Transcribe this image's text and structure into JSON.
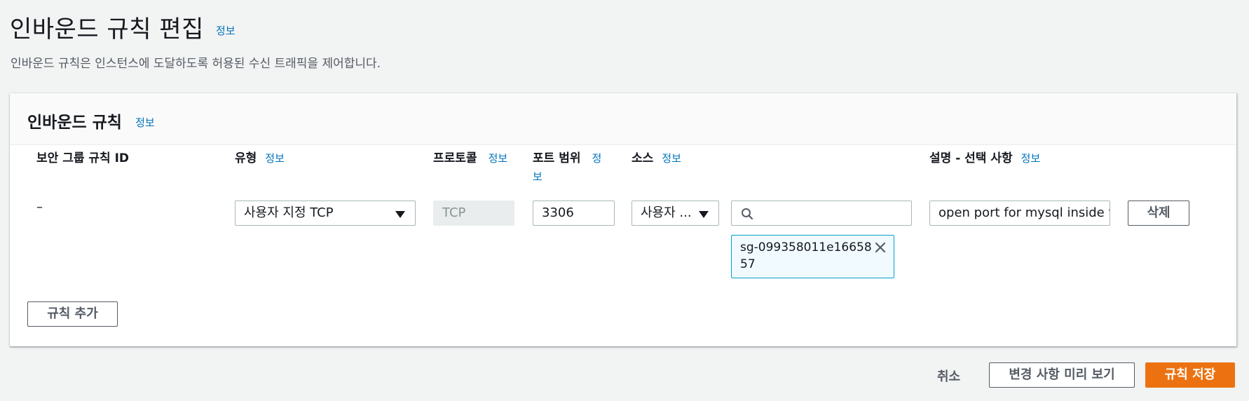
{
  "header": {
    "title": "인바운드 규칙 편집",
    "info": "정보",
    "description": "인바운드 규칙은 인스턴스에 도달하도록 허용된 수신 트래픽을 제어합니다."
  },
  "panel": {
    "title": "인바운드 규칙",
    "info": "정보",
    "columns": {
      "rule_id": "보안 그룹 규칙 ID",
      "type": "유형",
      "protocol": "프로토콜",
      "port_range": "포트 범위",
      "source": "소스",
      "description": "설명 - 선택 사항",
      "info": "정보"
    },
    "rule": {
      "rule_id": "–",
      "type": "사용자 지정 TCP",
      "protocol": "TCP",
      "port": "3306",
      "source_type": "사용자 ...",
      "source_search": "",
      "source_token": "sg-099358011e1665857",
      "description": "open port for mysql inside th",
      "delete": "삭제"
    },
    "add_rule": "규칙 추가"
  },
  "footer": {
    "cancel": "취소",
    "preview": "변경 사항 미리 보기",
    "save": "규칙 저장"
  },
  "colors": {
    "primary": "#ec7211",
    "link": "#0073bb",
    "token_border": "#00a1c9"
  }
}
